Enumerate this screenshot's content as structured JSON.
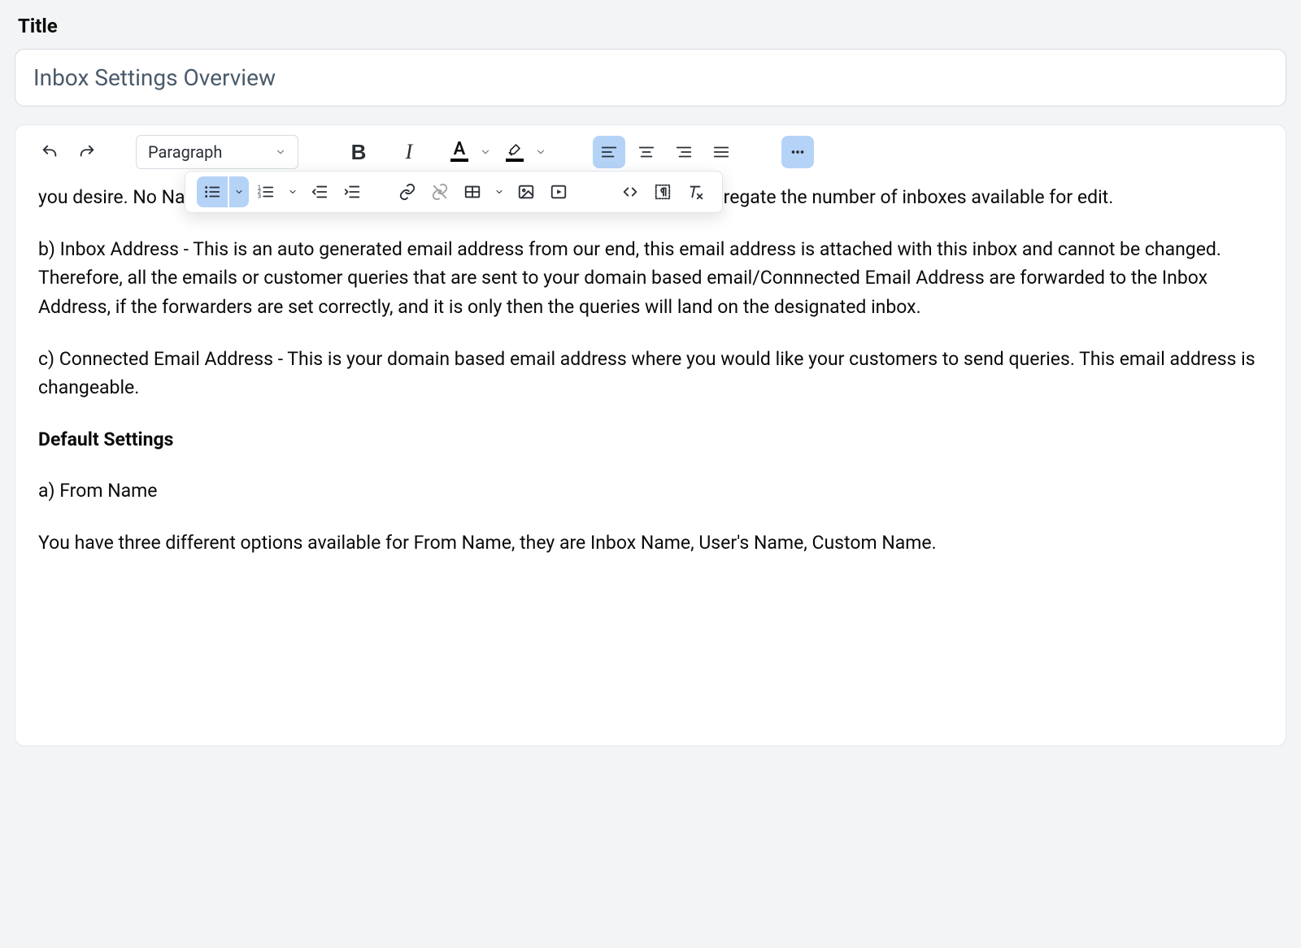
{
  "title_field": {
    "label": "Title",
    "value": "Inbox Settings Overview"
  },
  "toolbar_primary": {
    "block_format_label": "Paragraph",
    "undo_icon": "undo-icon",
    "redo_icon": "redo-icon",
    "bold_label": "B",
    "italic_label": "I",
    "text_color_letter": "A",
    "text_color_bar": "#000000",
    "highlight_color_bar": "#000000",
    "align_left_active": true,
    "more_active": true
  },
  "toolbar_secondary": {
    "bullet_list_active": true
  },
  "content": {
    "para_top_fragment": "you desire. No                                                                                                                                                                        Name (See below) of senders name are set as Inbox, it is just to segregate the number of inboxes available for edit.",
    "para_b": "b) Inbox Address - This is an auto generated email address from our end, this email address is attached with this inbox and cannot be changed. Therefore, all the emails or customer queries that are sent to your domain based email/Connnected Email Address are forwarded to the Inbox Address, if the forwarders are set correctly, and it is only then the queries will land on the designated inbox.",
    "para_c": "c) Connected Email Address - This is your domain based email address where you would like your customers to send queries. This email address is changeable.",
    "heading_default_settings": "Default Settings",
    "para_from_name_label": "a) From Name",
    "para_from_name_body": "You have three different options available for From Name, they are Inbox Name, User's Name, Custom Name."
  }
}
